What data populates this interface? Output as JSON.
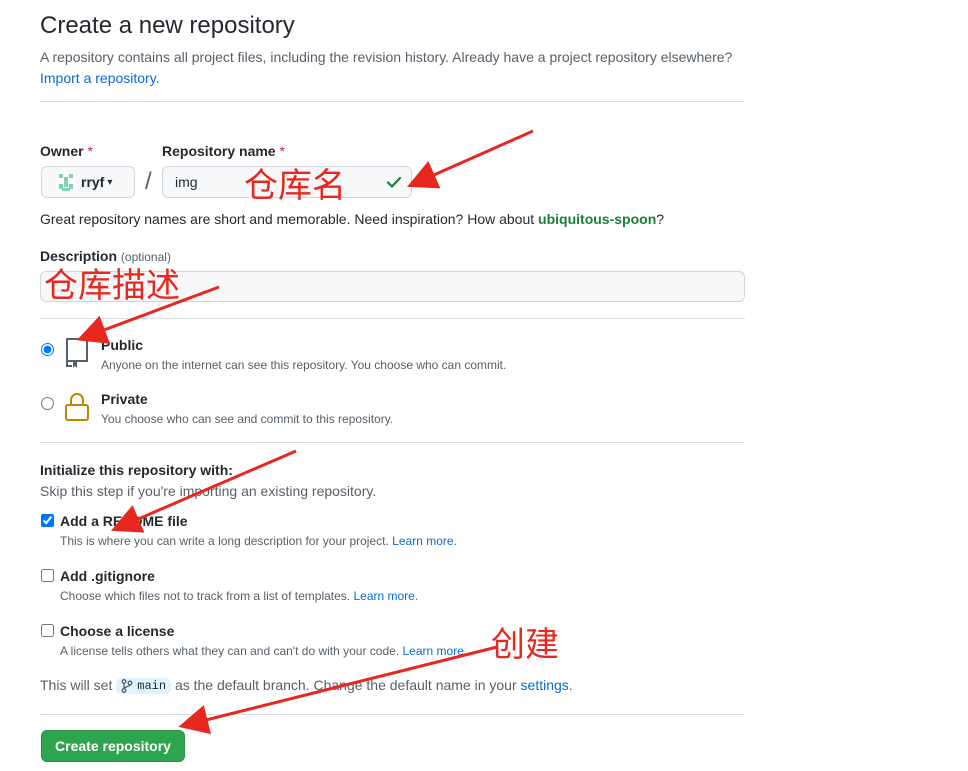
{
  "header": {
    "title": "Create a new repository",
    "subtitle": "A repository contains all project files, including the revision history. Already have a project repository elsewhere?",
    "import_link": "Import a repository."
  },
  "owner": {
    "label": "Owner",
    "required_mark": "*",
    "value": "rryf"
  },
  "repo_name": {
    "label": "Repository name",
    "required_mark": "*",
    "value": "img",
    "separator": "/"
  },
  "name_hint": {
    "prefix": "Great repository names are short and memorable. Need inspiration? How about ",
    "suggestion": "ubiquitous-spoon",
    "suffix": "?"
  },
  "description": {
    "label": "Description",
    "optional": "(optional)",
    "value": ""
  },
  "visibility": {
    "public": {
      "title": "Public",
      "desc": "Anyone on the internet can see this repository. You choose who can commit.",
      "selected": true
    },
    "private": {
      "title": "Private",
      "desc": "You choose who can see and commit to this repository.",
      "selected": false
    }
  },
  "init": {
    "title": "Initialize this repository with:",
    "subtitle": "Skip this step if you're importing an existing repository.",
    "readme": {
      "label": "Add a README file",
      "desc": "This is where you can write a long description for your project.",
      "learn": "Learn more.",
      "checked": true
    },
    "gitignore": {
      "label": "Add .gitignore",
      "desc": "Choose which files not to track from a list of templates.",
      "learn": "Learn more.",
      "checked": false
    },
    "license": {
      "label": "Choose a license",
      "desc": "A license tells others what they can and can't do with your code.",
      "learn": "Learn more.",
      "checked": false
    }
  },
  "branch_note": {
    "prefix": "This will set",
    "branch": "main",
    "middle": "as the default branch. Change the default name in your",
    "link": "settings",
    "suffix": "."
  },
  "submit": {
    "label": "Create repository"
  },
  "annotations": {
    "repo_name": "仓库名",
    "description": "仓库描述",
    "create": "创建"
  },
  "colors": {
    "accent_link": "#0969da",
    "primary_button": "#2da44e",
    "annotation_red": "#e8281e",
    "suggestion_green": "#1a7f37"
  },
  "icons": {
    "owner_avatar": "identicon-avatar",
    "name_valid": "check-icon",
    "public": "repo-book-icon",
    "private": "lock-icon",
    "branch": "git-branch-icon"
  }
}
